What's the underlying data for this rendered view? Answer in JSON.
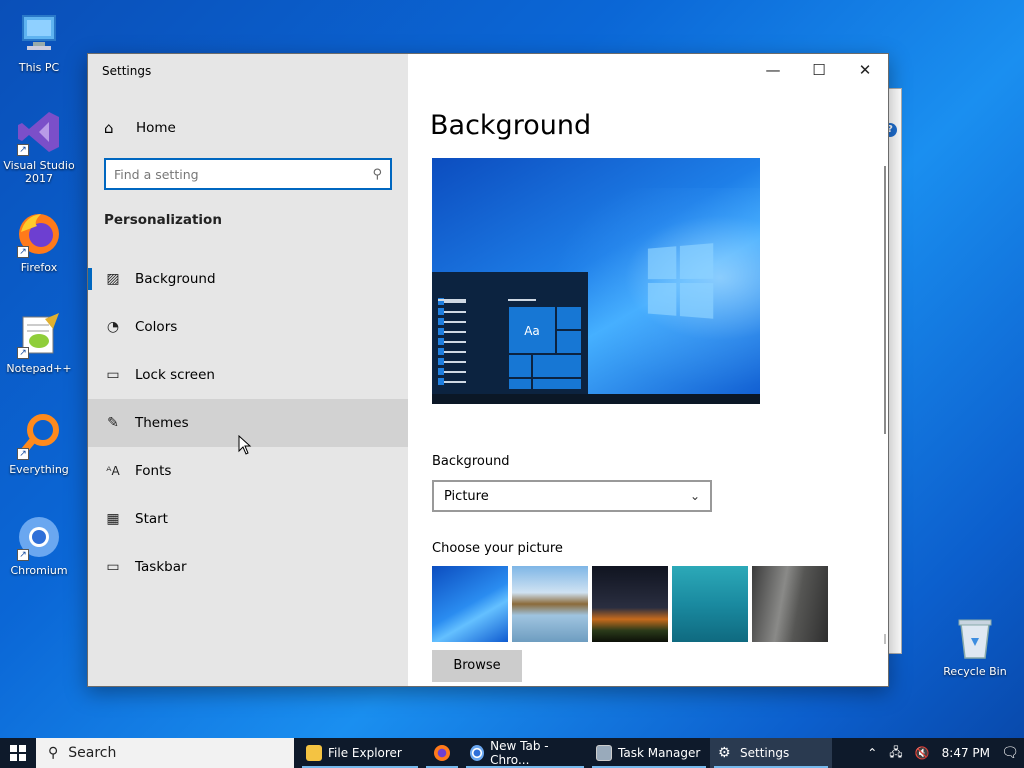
{
  "desktop": {
    "icons": [
      {
        "label": "This PC",
        "icon": "computer-icon"
      },
      {
        "label": "Visual Studio 2017",
        "icon": "visual-studio-icon"
      },
      {
        "label": "Firefox",
        "icon": "firefox-icon"
      },
      {
        "label": "Notepad++",
        "icon": "notepadpp-icon"
      },
      {
        "label": "Everything",
        "icon": "everything-search-icon"
      },
      {
        "label": "Chromium",
        "icon": "chromium-icon"
      }
    ],
    "recycle_bin": "Recycle Bin"
  },
  "settings": {
    "window_title": "Settings",
    "controls": {
      "minimize": "—",
      "maximize": "☐",
      "close": "✕"
    },
    "home_label": "Home",
    "search_placeholder": "Find a setting",
    "section_title": "Personalization",
    "nav_items": [
      {
        "label": "Background",
        "icon": "picture-icon",
        "selected": true
      },
      {
        "label": "Colors",
        "icon": "palette-icon"
      },
      {
        "label": "Lock screen",
        "icon": "lock-screen-icon"
      },
      {
        "label": "Themes",
        "icon": "themes-icon",
        "hover": true
      },
      {
        "label": "Fonts",
        "icon": "fonts-icon"
      },
      {
        "label": "Start",
        "icon": "start-icon"
      },
      {
        "label": "Taskbar",
        "icon": "taskbar-icon"
      }
    ],
    "page_title": "Background",
    "preview_tile_text": "Aa",
    "background_label": "Background",
    "background_value": "Picture",
    "choose_picture_label": "Choose your picture",
    "thumbnails": [
      "windows-blue",
      "beach-rocks",
      "night-sky",
      "underwater",
      "rock-cliff"
    ],
    "browse_label": "Browse"
  },
  "taskbar": {
    "search_label": "Search",
    "apps": [
      {
        "label": "File Explorer",
        "icon": "folder-icon"
      },
      {
        "label": "",
        "icon": "firefox-icon"
      },
      {
        "label": "New Tab - Chro...",
        "icon": "chromium-icon"
      },
      {
        "label": "Task Manager",
        "icon": "task-manager-icon"
      },
      {
        "label": "Settings",
        "icon": "gear-icon",
        "active": true
      }
    ],
    "clock": "8:47 PM"
  }
}
